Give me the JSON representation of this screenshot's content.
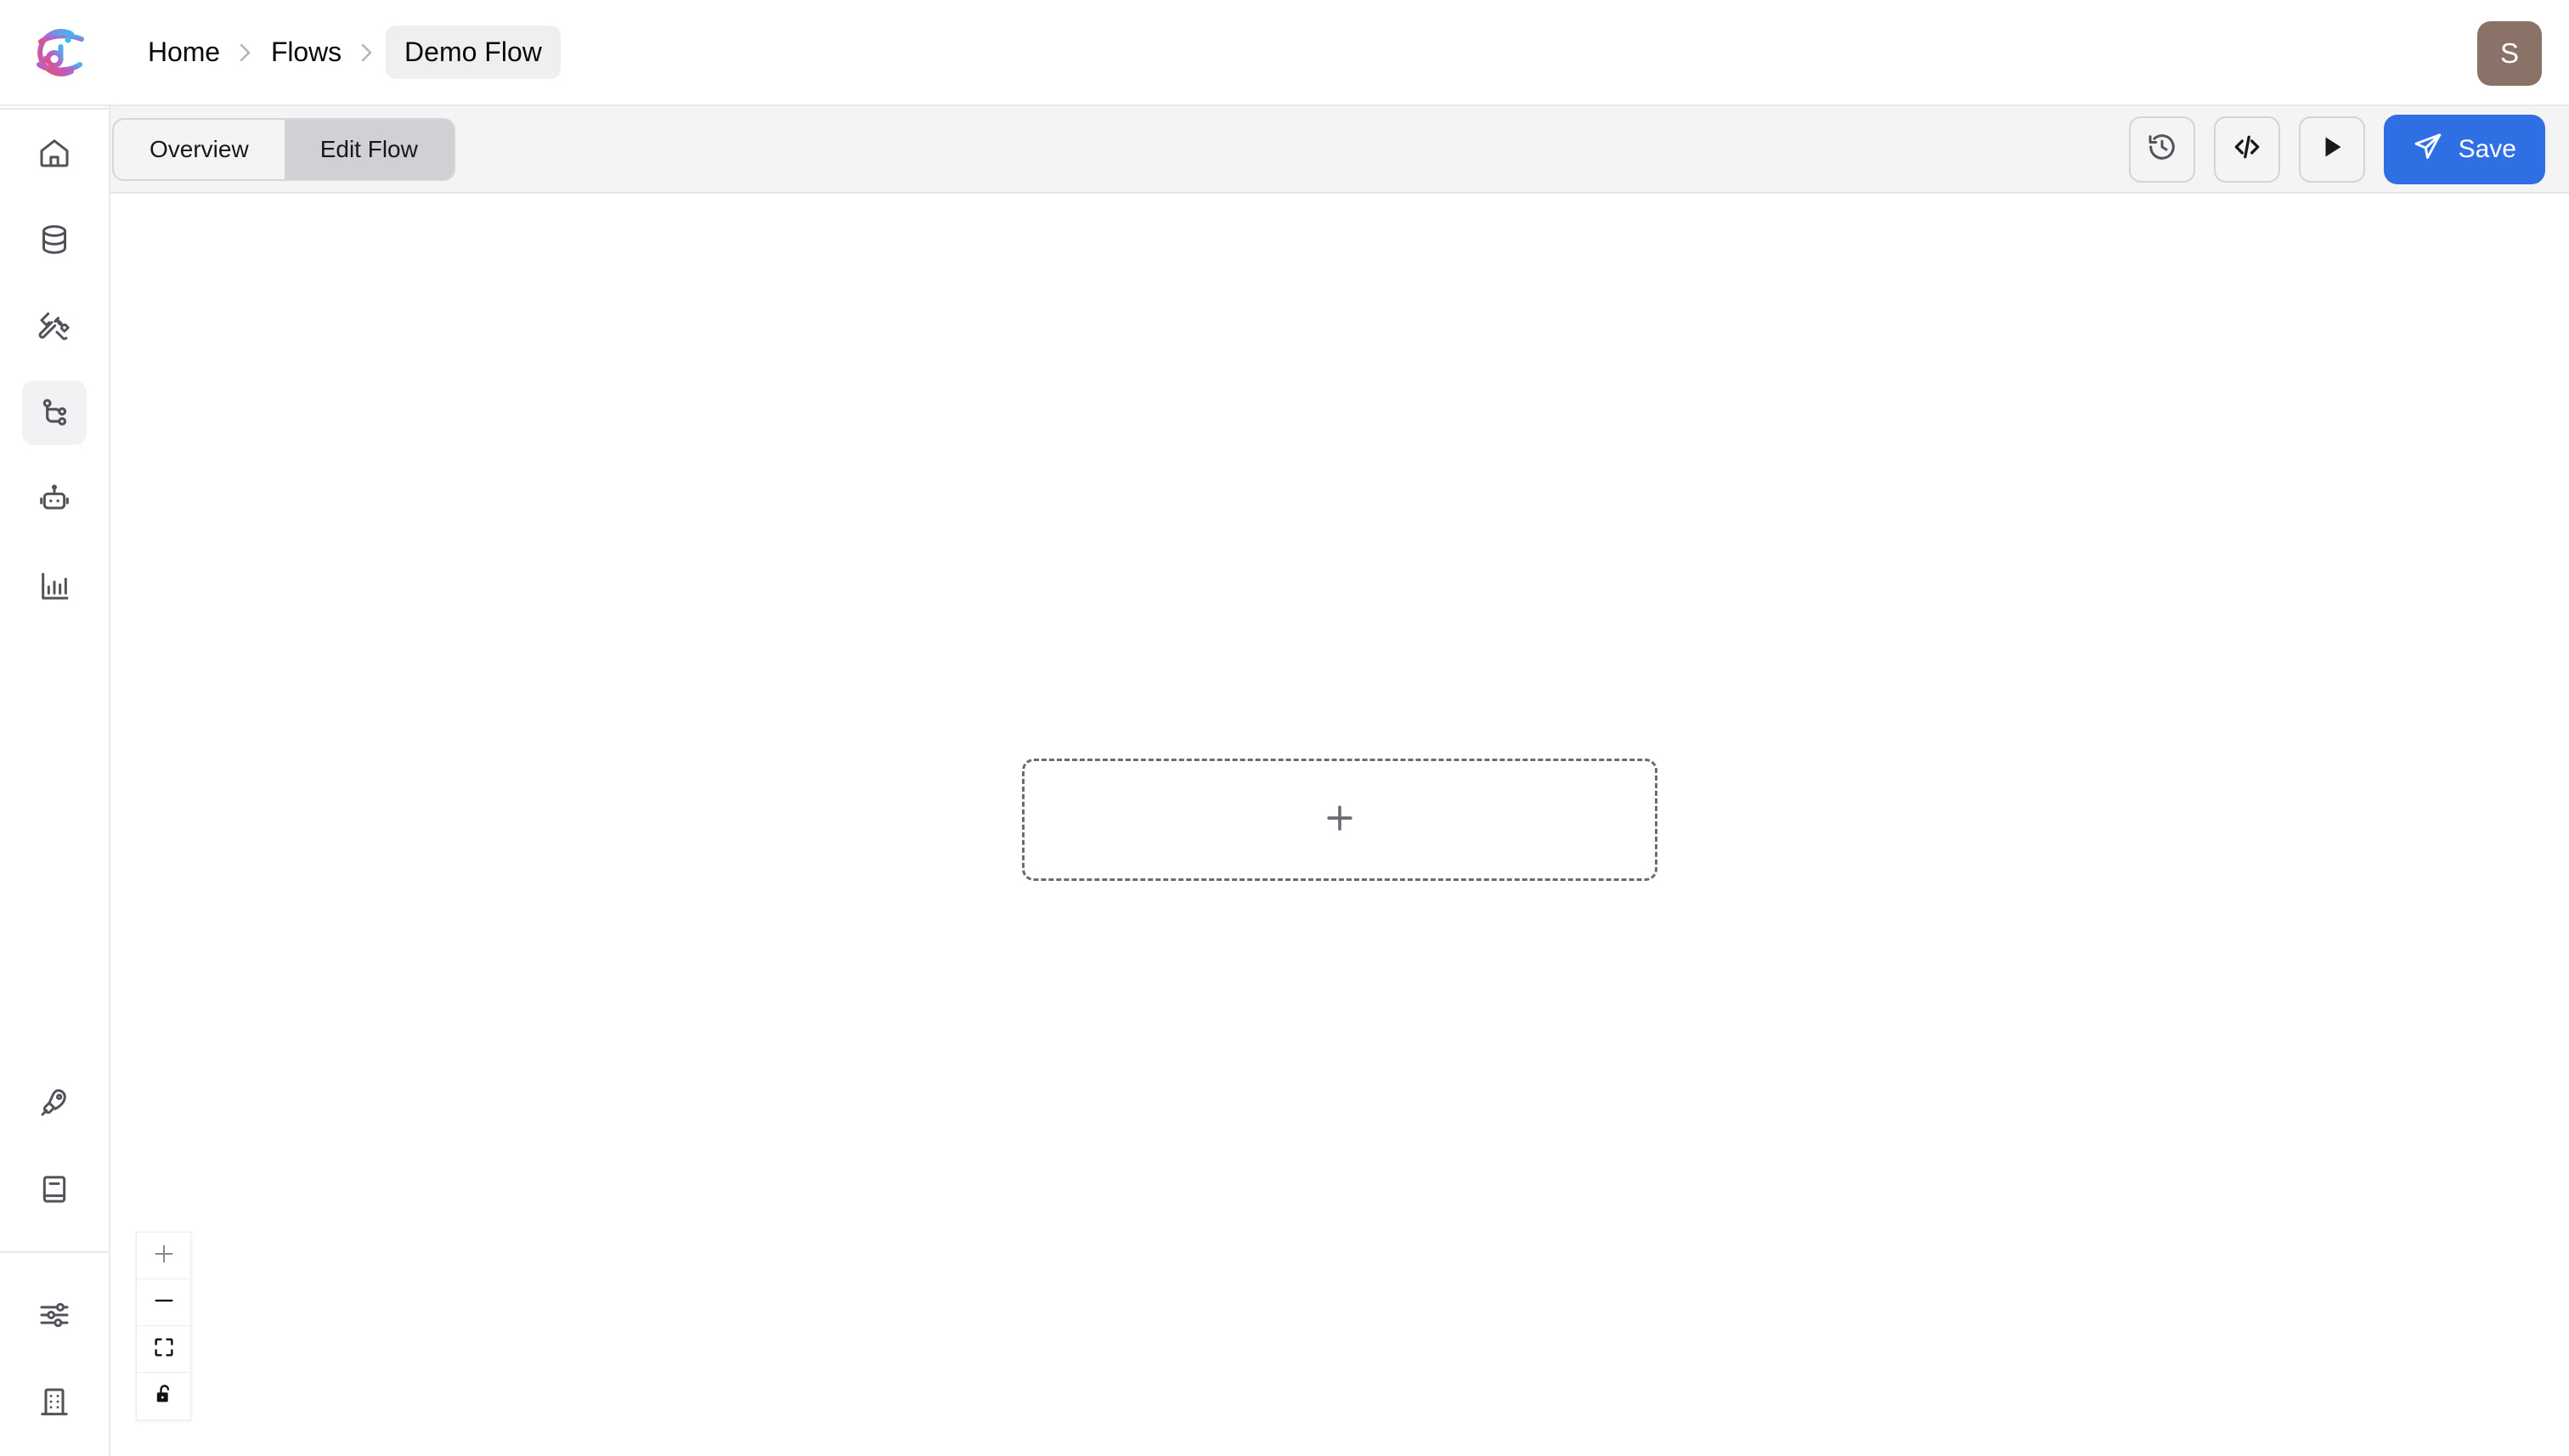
{
  "app": {
    "logo_alt": "dot-ai-logo",
    "background": "#ffffff",
    "accent": "#2f6fe4"
  },
  "header": {
    "breadcrumb": [
      {
        "label": "Home",
        "current": false
      },
      {
        "label": "Flows",
        "current": false
      },
      {
        "label": "Demo Flow",
        "current": true
      }
    ],
    "separator": "›",
    "avatar": {
      "initial": "S",
      "color": "#8a7268"
    }
  },
  "sidebar": {
    "top_items": [
      {
        "label": "Home",
        "icon": "home-icon",
        "active": false
      },
      {
        "label": "Data",
        "icon": "database-icon",
        "active": false
      },
      {
        "label": "Tools",
        "icon": "tools-icon",
        "active": false
      },
      {
        "label": "Flows",
        "icon": "flow-branch-icon",
        "active": true
      },
      {
        "label": "Agents",
        "icon": "robot-icon",
        "active": false
      },
      {
        "label": "Analytics",
        "icon": "bar-chart-icon",
        "active": false
      }
    ],
    "bottom_items": [
      {
        "label": "Deploy",
        "icon": "rocket-icon",
        "active": false
      },
      {
        "label": "Docs",
        "icon": "book-icon",
        "active": false
      }
    ],
    "footer_items": [
      {
        "label": "Settings",
        "icon": "sliders-icon",
        "active": false
      },
      {
        "label": "Organization",
        "icon": "building-icon",
        "active": false
      }
    ]
  },
  "toolbar": {
    "tabs": [
      {
        "label": "Overview",
        "active": false
      },
      {
        "label": "Edit Flow",
        "active": true
      }
    ],
    "actions": [
      {
        "label": "History",
        "icon": "history-clock-icon"
      },
      {
        "label": "Code",
        "icon": "code-brackets-icon"
      },
      {
        "label": "Run",
        "icon": "play-icon"
      }
    ],
    "save_label": "Save",
    "save_icon": "send-plane-icon",
    "save_color": "#2f6fe4"
  },
  "canvas": {
    "placeholder": {
      "label": "",
      "icon": "plus-icon",
      "hint": "add-node"
    },
    "controls": [
      {
        "label": "Zoom in",
        "icon": "plus-icon"
      },
      {
        "label": "Zoom out",
        "icon": "minus-icon"
      },
      {
        "label": "Fit view",
        "icon": "fit-view-icon"
      },
      {
        "label": "Toggle interactivity",
        "icon": "unlock-icon"
      }
    ]
  }
}
